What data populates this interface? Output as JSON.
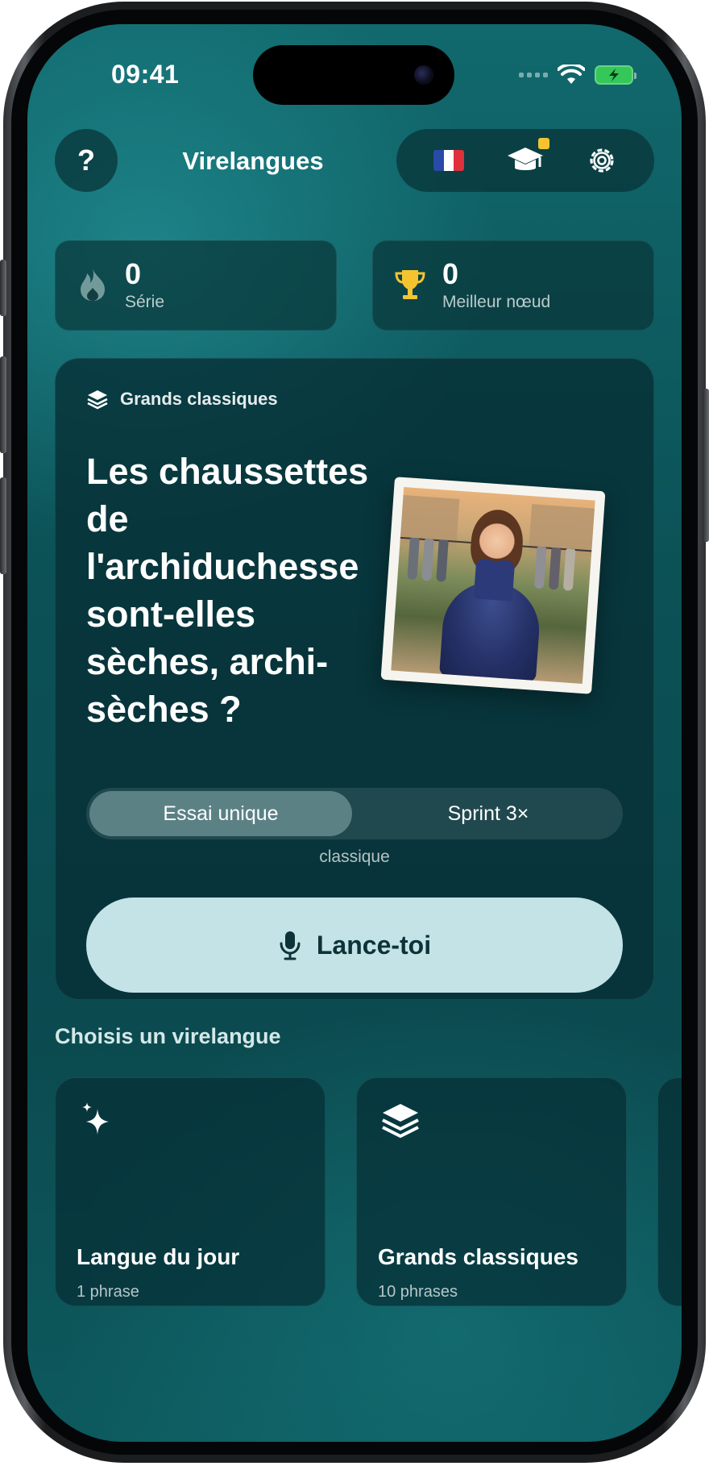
{
  "status_bar": {
    "time": "09:41"
  },
  "header": {
    "help_label": "?",
    "title": "Virelangues",
    "flag_icon": "french-flag-icon",
    "hat_icon": "graduation-cap-icon",
    "settings_icon": "gear-icon"
  },
  "stats": [
    {
      "icon": "flame-icon",
      "value": "0",
      "label": "Série"
    },
    {
      "icon": "trophy-icon",
      "value": "0",
      "label": "Meilleur nœud"
    }
  ],
  "current_card": {
    "category_icon": "layers-icon",
    "category": "Grands classiques",
    "phrase": "Les chaussettes de l'archiduchesse sont-elles sèches, archi-sèches ?",
    "mode_options": [
      "Essai unique",
      "Sprint 3×"
    ],
    "selected_mode": "Essai unique",
    "mode_hint": "classique",
    "launch_icon": "microphone-icon",
    "launch_label": "Lance-toi"
  },
  "section": {
    "title": "Choisis un virelangue"
  },
  "categories": [
    {
      "icon": "sparkles-icon",
      "name": "Langue du jour",
      "count": "1 phrase"
    },
    {
      "icon": "layers-icon",
      "name": "Grands classiques",
      "count": "10 phrases"
    }
  ],
  "colors": {
    "background": "#0b5156",
    "card": "#063034",
    "accent_button": "#c4e3e7",
    "trophy": "#f4c430",
    "battery": "#35c759"
  }
}
